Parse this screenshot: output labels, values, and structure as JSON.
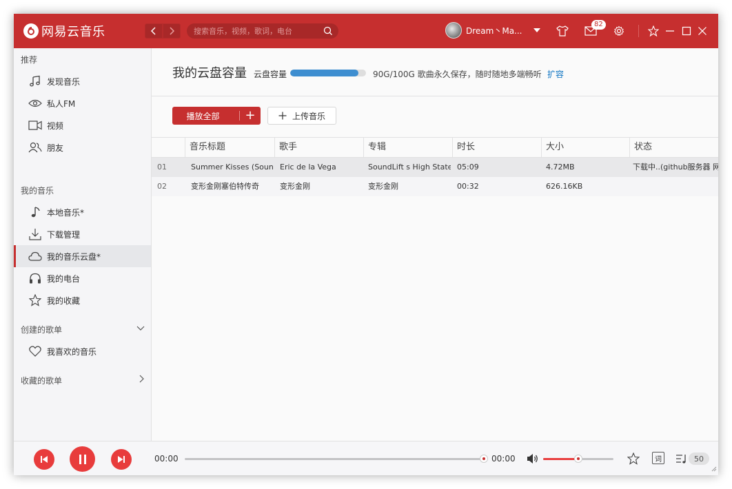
{
  "app": {
    "name": "网易云音乐"
  },
  "colors": {
    "brand": "#c62f2f",
    "accent_blue": "#0c73c2",
    "progress_blue": "#3e8ed0"
  },
  "header": {
    "search_placeholder": "搜索音乐，视频，歌词，电台",
    "username": "Dream丶Ma...",
    "message_count": "82"
  },
  "sidebar": {
    "recommend_title": "推荐",
    "recommend_items": [
      {
        "label": "发现音乐",
        "icon": "music-note-icon"
      },
      {
        "label": "私人FM",
        "icon": "radio-eye-icon"
      },
      {
        "label": "视频",
        "icon": "video-icon"
      },
      {
        "label": "朋友",
        "icon": "friends-icon"
      }
    ],
    "my_music_title": "我的音乐",
    "my_music_items": [
      {
        "label": "本地音乐*",
        "icon": "note-icon"
      },
      {
        "label": "下载管理",
        "icon": "download-icon"
      },
      {
        "label": "我的音乐云盘*",
        "icon": "cloud-icon",
        "active": true
      },
      {
        "label": "我的电台",
        "icon": "headphones-icon"
      },
      {
        "label": "我的收藏",
        "icon": "star-icon"
      }
    ],
    "created_title": "创建的歌单",
    "created_items": [
      {
        "label": "我喜欢的音乐",
        "icon": "heart-icon"
      }
    ],
    "collected_title": "收藏的歌单"
  },
  "main": {
    "title": "我的云盘容量",
    "capacity_label": "云盘容量",
    "capacity_fraction": 0.9,
    "capacity_text": "90G/100G  歌曲永久保存，随时随地多端畅听",
    "expand_link": "扩容",
    "play_all": "播放全部",
    "upload": "上传音乐",
    "columns": [
      "音乐标题",
      "歌手",
      "专辑",
      "时长",
      "大小",
      "状态"
    ],
    "rows": [
      {
        "idx": "01",
        "title": "Summer Kisses (Sound",
        "artist": "Eric de la Vega",
        "album": "SoundLift s High State",
        "duration": "05:09",
        "size": "4.72MB",
        "status": "下载中..(github服务器 网"
      },
      {
        "idx": "02",
        "title": "变形金刚塞伯特传奇",
        "artist": "变形金刚",
        "album": "变形金刚",
        "duration": "00:32",
        "size": "626.16KB",
        "status": ""
      }
    ]
  },
  "player": {
    "current_time": "00:00",
    "total_time": "00:00",
    "progress_fraction": 1.0,
    "volume_fraction": 0.5,
    "lyric_label": "词",
    "playlist_count": "50"
  }
}
